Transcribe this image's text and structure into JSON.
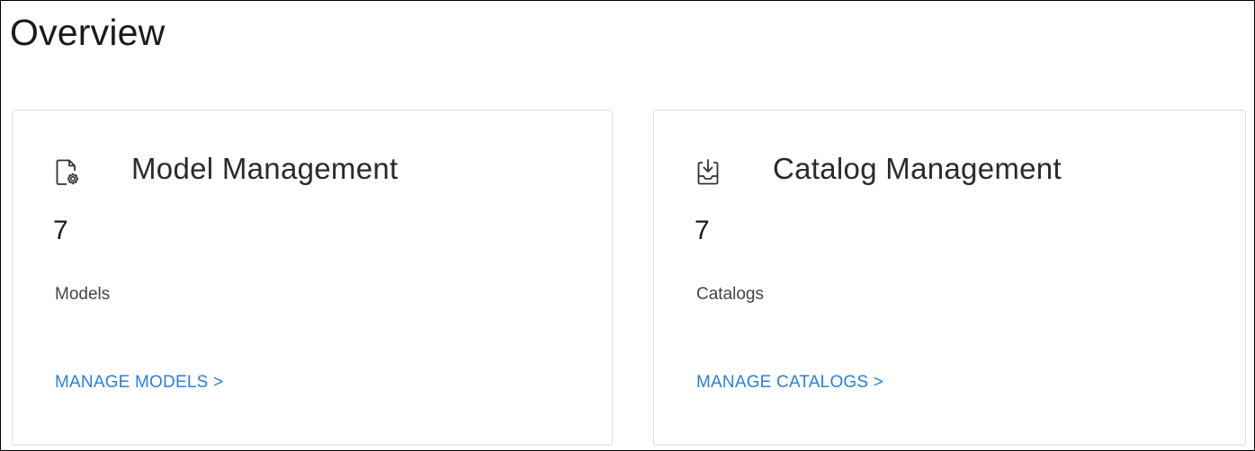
{
  "page": {
    "title": "Overview"
  },
  "cards": [
    {
      "icon": "model-settings-icon",
      "title": "Model Management",
      "count": "7",
      "caption": "Models",
      "link_label": "MANAGE MODELS >"
    },
    {
      "icon": "catalog-download-icon",
      "title": "Catalog Management",
      "count": "7",
      "caption": "Catalogs",
      "link_label": "MANAGE CATALOGS >"
    }
  ],
  "colors": {
    "link": "#2b7fd6",
    "card_border": "#dcdcdc",
    "text": "#1a1a1a"
  }
}
